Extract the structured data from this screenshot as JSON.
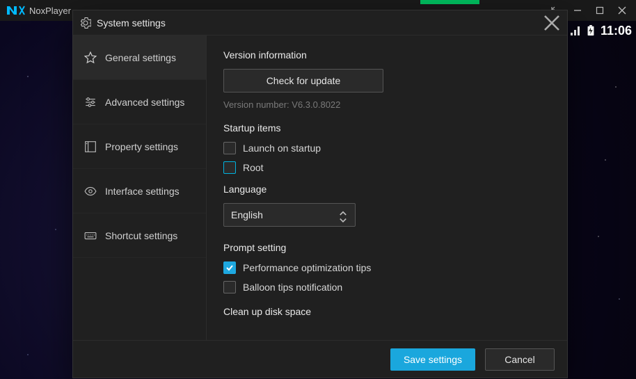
{
  "app": {
    "title": "NoxPlayer"
  },
  "android_status": {
    "time": "11:06"
  },
  "dialog": {
    "title": "System settings",
    "sidebar": {
      "items": [
        {
          "label": "General settings"
        },
        {
          "label": "Advanced settings"
        },
        {
          "label": "Property settings"
        },
        {
          "label": "Interface settings"
        },
        {
          "label": "Shortcut settings"
        }
      ],
      "active_index": 0
    },
    "content": {
      "version_section": {
        "title": "Version information",
        "check_update_label": "Check for update",
        "version_text": "Version number: V6.3.0.8022"
      },
      "startup_section": {
        "title": "Startup items",
        "launch_label": "Launch on startup",
        "launch_checked": false,
        "root_label": "Root",
        "root_checked": false
      },
      "language_section": {
        "title": "Language",
        "selected": "English"
      },
      "prompt_section": {
        "title": "Prompt setting",
        "perf_label": "Performance optimization tips",
        "perf_checked": true,
        "balloon_label": "Balloon tips notification",
        "balloon_checked": false
      },
      "cleanup_section": {
        "title": "Clean up disk space"
      }
    },
    "footer": {
      "save_label": "Save settings",
      "cancel_label": "Cancel"
    }
  },
  "colors": {
    "accent": "#1aa7dd",
    "bg_dialog": "#202020",
    "bg_titlebar": "#1a1a1a"
  }
}
